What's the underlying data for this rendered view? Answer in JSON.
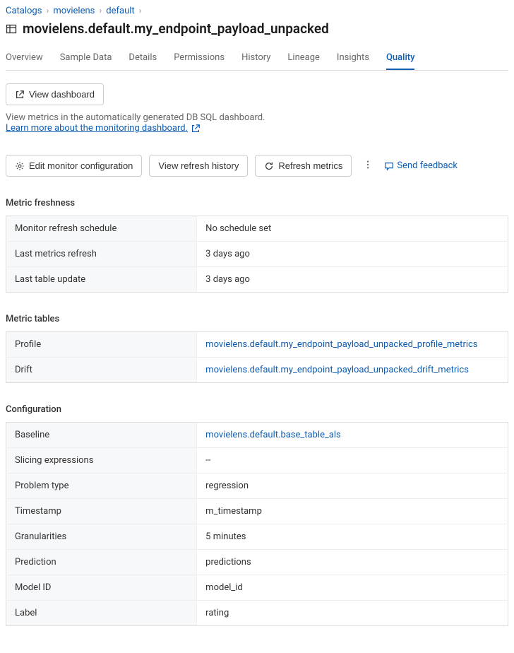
{
  "breadcrumb": {
    "items": [
      "Catalogs",
      "movielens",
      "default"
    ]
  },
  "page_title": "movielens.default.my_endpoint_payload_unpacked",
  "tabs": {
    "items": [
      "Overview",
      "Sample Data",
      "Details",
      "Permissions",
      "History",
      "Lineage",
      "Insights",
      "Quality"
    ],
    "active": "Quality"
  },
  "view_dashboard": {
    "button_label": "View dashboard",
    "helper": "View metrics in the automatically generated DB SQL dashboard.",
    "learn_more": "Learn more about the monitoring dashboard."
  },
  "actions": {
    "edit_monitor": "Edit monitor configuration",
    "view_refresh_history": "View refresh history",
    "refresh_metrics": "Refresh metrics",
    "send_feedback": "Send feedback"
  },
  "metric_freshness": {
    "title": "Metric freshness",
    "rows": [
      {
        "label": "Monitor refresh schedule",
        "value": "No schedule set"
      },
      {
        "label": "Last metrics refresh",
        "value": "3 days ago"
      },
      {
        "label": "Last table update",
        "value": "3 days ago"
      }
    ]
  },
  "metric_tables": {
    "title": "Metric tables",
    "rows": [
      {
        "label": "Profile",
        "value": "movielens.default.my_endpoint_payload_unpacked_profile_metrics",
        "is_link": true
      },
      {
        "label": "Drift",
        "value": "movielens.default.my_endpoint_payload_unpacked_drift_metrics",
        "is_link": true
      }
    ]
  },
  "configuration": {
    "title": "Configuration",
    "rows": [
      {
        "label": "Baseline",
        "value": "movielens.default.base_table_als",
        "is_link": true
      },
      {
        "label": "Slicing expressions",
        "value": "--"
      },
      {
        "label": "Problem type",
        "value": "regression"
      },
      {
        "label": "Timestamp",
        "value": "m_timestamp"
      },
      {
        "label": "Granularities",
        "value": "5 minutes"
      },
      {
        "label": "Prediction",
        "value": "predictions"
      },
      {
        "label": "Model ID",
        "value": "model_id"
      },
      {
        "label": "Label",
        "value": "rating"
      }
    ]
  }
}
